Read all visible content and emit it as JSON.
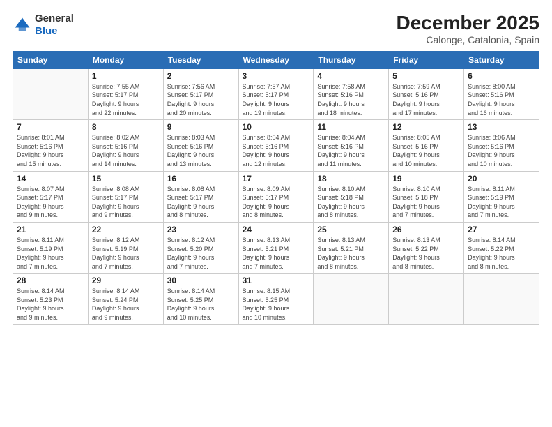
{
  "header": {
    "logo_general": "General",
    "logo_blue": "Blue",
    "month_year": "December 2025",
    "location": "Calonge, Catalonia, Spain"
  },
  "days_of_week": [
    "Sunday",
    "Monday",
    "Tuesday",
    "Wednesday",
    "Thursday",
    "Friday",
    "Saturday"
  ],
  "weeks": [
    [
      {
        "day": "",
        "info": ""
      },
      {
        "day": "1",
        "info": "Sunrise: 7:55 AM\nSunset: 5:17 PM\nDaylight: 9 hours\nand 22 minutes."
      },
      {
        "day": "2",
        "info": "Sunrise: 7:56 AM\nSunset: 5:17 PM\nDaylight: 9 hours\nand 20 minutes."
      },
      {
        "day": "3",
        "info": "Sunrise: 7:57 AM\nSunset: 5:17 PM\nDaylight: 9 hours\nand 19 minutes."
      },
      {
        "day": "4",
        "info": "Sunrise: 7:58 AM\nSunset: 5:16 PM\nDaylight: 9 hours\nand 18 minutes."
      },
      {
        "day": "5",
        "info": "Sunrise: 7:59 AM\nSunset: 5:16 PM\nDaylight: 9 hours\nand 17 minutes."
      },
      {
        "day": "6",
        "info": "Sunrise: 8:00 AM\nSunset: 5:16 PM\nDaylight: 9 hours\nand 16 minutes."
      }
    ],
    [
      {
        "day": "7",
        "info": "Sunrise: 8:01 AM\nSunset: 5:16 PM\nDaylight: 9 hours\nand 15 minutes."
      },
      {
        "day": "8",
        "info": "Sunrise: 8:02 AM\nSunset: 5:16 PM\nDaylight: 9 hours\nand 14 minutes."
      },
      {
        "day": "9",
        "info": "Sunrise: 8:03 AM\nSunset: 5:16 PM\nDaylight: 9 hours\nand 13 minutes."
      },
      {
        "day": "10",
        "info": "Sunrise: 8:04 AM\nSunset: 5:16 PM\nDaylight: 9 hours\nand 12 minutes."
      },
      {
        "day": "11",
        "info": "Sunrise: 8:04 AM\nSunset: 5:16 PM\nDaylight: 9 hours\nand 11 minutes."
      },
      {
        "day": "12",
        "info": "Sunrise: 8:05 AM\nSunset: 5:16 PM\nDaylight: 9 hours\nand 10 minutes."
      },
      {
        "day": "13",
        "info": "Sunrise: 8:06 AM\nSunset: 5:16 PM\nDaylight: 9 hours\nand 10 minutes."
      }
    ],
    [
      {
        "day": "14",
        "info": "Sunrise: 8:07 AM\nSunset: 5:17 PM\nDaylight: 9 hours\nand 9 minutes."
      },
      {
        "day": "15",
        "info": "Sunrise: 8:08 AM\nSunset: 5:17 PM\nDaylight: 9 hours\nand 9 minutes."
      },
      {
        "day": "16",
        "info": "Sunrise: 8:08 AM\nSunset: 5:17 PM\nDaylight: 9 hours\nand 8 minutes."
      },
      {
        "day": "17",
        "info": "Sunrise: 8:09 AM\nSunset: 5:17 PM\nDaylight: 9 hours\nand 8 minutes."
      },
      {
        "day": "18",
        "info": "Sunrise: 8:10 AM\nSunset: 5:18 PM\nDaylight: 9 hours\nand 8 minutes."
      },
      {
        "day": "19",
        "info": "Sunrise: 8:10 AM\nSunset: 5:18 PM\nDaylight: 9 hours\nand 7 minutes."
      },
      {
        "day": "20",
        "info": "Sunrise: 8:11 AM\nSunset: 5:19 PM\nDaylight: 9 hours\nand 7 minutes."
      }
    ],
    [
      {
        "day": "21",
        "info": "Sunrise: 8:11 AM\nSunset: 5:19 PM\nDaylight: 9 hours\nand 7 minutes."
      },
      {
        "day": "22",
        "info": "Sunrise: 8:12 AM\nSunset: 5:19 PM\nDaylight: 9 hours\nand 7 minutes."
      },
      {
        "day": "23",
        "info": "Sunrise: 8:12 AM\nSunset: 5:20 PM\nDaylight: 9 hours\nand 7 minutes."
      },
      {
        "day": "24",
        "info": "Sunrise: 8:13 AM\nSunset: 5:21 PM\nDaylight: 9 hours\nand 7 minutes."
      },
      {
        "day": "25",
        "info": "Sunrise: 8:13 AM\nSunset: 5:21 PM\nDaylight: 9 hours\nand 8 minutes."
      },
      {
        "day": "26",
        "info": "Sunrise: 8:13 AM\nSunset: 5:22 PM\nDaylight: 9 hours\nand 8 minutes."
      },
      {
        "day": "27",
        "info": "Sunrise: 8:14 AM\nSunset: 5:22 PM\nDaylight: 9 hours\nand 8 minutes."
      }
    ],
    [
      {
        "day": "28",
        "info": "Sunrise: 8:14 AM\nSunset: 5:23 PM\nDaylight: 9 hours\nand 9 minutes."
      },
      {
        "day": "29",
        "info": "Sunrise: 8:14 AM\nSunset: 5:24 PM\nDaylight: 9 hours\nand 9 minutes."
      },
      {
        "day": "30",
        "info": "Sunrise: 8:14 AM\nSunset: 5:25 PM\nDaylight: 9 hours\nand 10 minutes."
      },
      {
        "day": "31",
        "info": "Sunrise: 8:15 AM\nSunset: 5:25 PM\nDaylight: 9 hours\nand 10 minutes."
      },
      {
        "day": "",
        "info": ""
      },
      {
        "day": "",
        "info": ""
      },
      {
        "day": "",
        "info": ""
      }
    ]
  ]
}
